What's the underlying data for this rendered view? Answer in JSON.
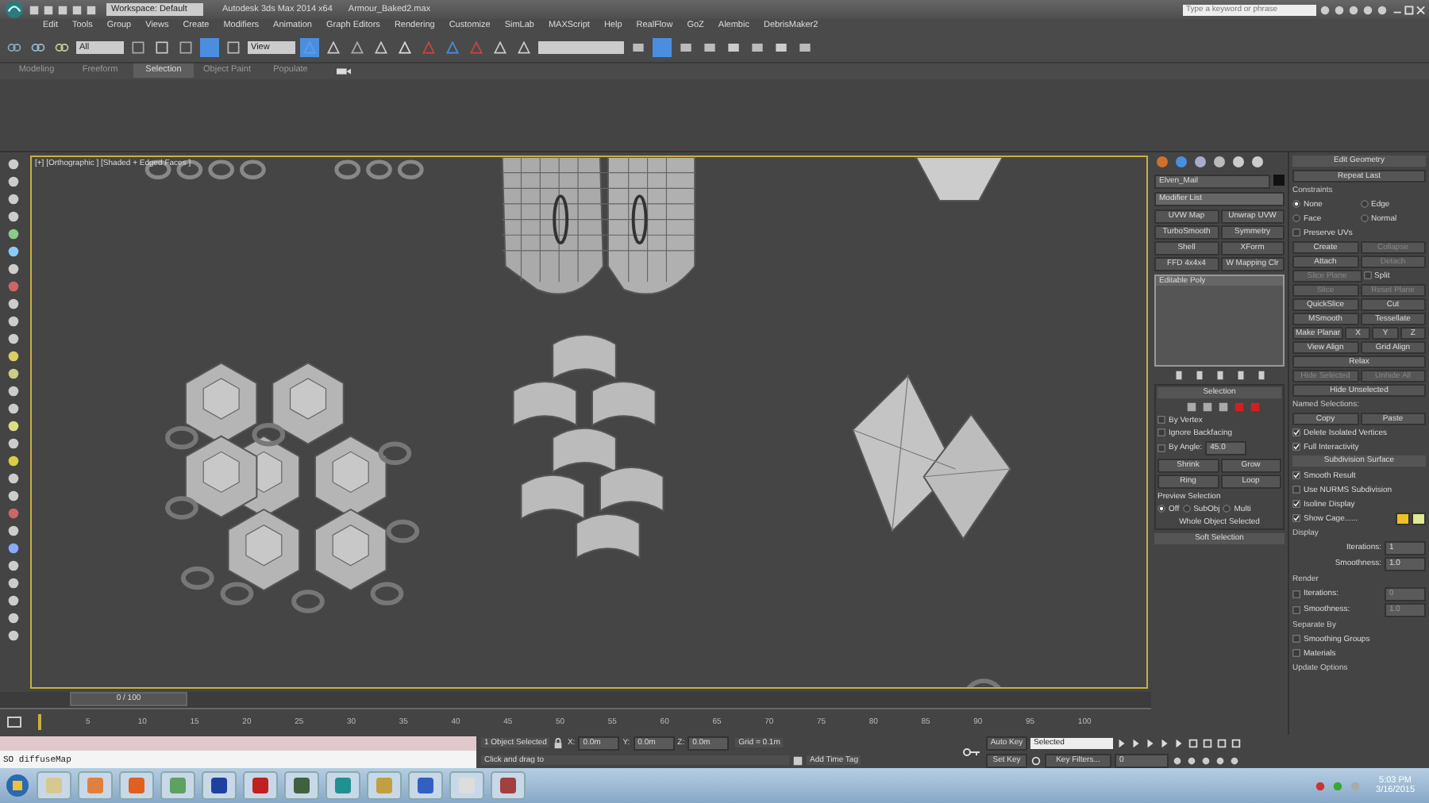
{
  "title_bar": {
    "workspace": "Workspace: Default",
    "title": "Autodesk 3ds Max 2014 x64",
    "file": "Armour_Baked2.max",
    "search": {
      "placeholder": "Type a keyword or phrase"
    }
  },
  "menu": [
    "Edit",
    "Tools",
    "Group",
    "Views",
    "Create",
    "Modifiers",
    "Animation",
    "Graph Editors",
    "Rendering",
    "Customize",
    "SimLab",
    "MAXScript",
    "Help",
    "RealFlow",
    "GoZ",
    "Alembic",
    "DebrisMaker2"
  ],
  "toolbar": {
    "selection_filter": "All",
    "reference_coord": "View"
  },
  "ribbon_tabs": [
    {
      "label": "Modeling",
      "selected": false
    },
    {
      "label": "Freeform",
      "selected": false
    },
    {
      "label": "Selection",
      "selected": true
    },
    {
      "label": "Object Paint",
      "selected": false
    },
    {
      "label": "Populate",
      "selected": false
    }
  ],
  "viewport": {
    "label": "[+] [Orthographic ] [Shaded + Edged Faces ]"
  },
  "command_panel": {
    "object_name": "Elven_Mail",
    "modifier_list": "Modifier List",
    "modifier_buttons": [
      "UVW Map",
      "Unwrap UVW",
      "TurboSmooth",
      "Symmetry",
      "Shell",
      "XForm",
      "FFD 4x4x4",
      "W Mapping Clr"
    ],
    "stack": [
      {
        "label": "Editable Poly",
        "selected": true
      }
    ],
    "selection": {
      "title": "Selection",
      "checks": [
        {
          "label": "By Vertex",
          "checked": false
        },
        {
          "label": "Ignore Backfacing",
          "checked": false
        },
        {
          "label": "By Angle:",
          "checked": false
        }
      ],
      "angle": "45.0",
      "buttons": [
        "Shrink",
        "Grow",
        "Ring",
        "Loop"
      ],
      "preview_title": "Preview Selection",
      "preview": [
        {
          "label": "Off",
          "selected": true
        },
        {
          "label": "SubObj",
          "selected": false
        },
        {
          "label": "Multi",
          "selected": false
        }
      ],
      "status": "Whole Object Selected"
    },
    "soft_selection": "Soft Selection"
  },
  "edit_geometry": {
    "rows": [
      [
        {
          "kind": "header",
          "label": "Edit Geometry"
        }
      ],
      [
        {
          "kind": "button",
          "label": "Repeat Last",
          "disabled": false
        }
      ],
      [
        {
          "kind": "label",
          "label": "Constraints"
        }
      ],
      [
        {
          "kind": "radio",
          "label": "None",
          "selected": true
        },
        {
          "kind": "radio",
          "label": "Edge",
          "selected": false
        }
      ],
      [
        {
          "kind": "radio",
          "label": "Face",
          "selected": false
        },
        {
          "kind": "radio",
          "label": "Normal",
          "selected": false
        }
      ],
      [
        {
          "kind": "check",
          "label": "Preserve UVs",
          "checked": false
        }
      ],
      [
        {
          "kind": "button",
          "label": "Create",
          "disabled": false
        },
        {
          "kind": "button",
          "label": "Collapse",
          "disabled": true
        }
      ],
      [
        {
          "kind": "button",
          "label": "Attach",
          "disabled": false
        },
        {
          "kind": "button",
          "label": "Detach",
          "disabled": true
        }
      ],
      [
        {
          "kind": "button",
          "label": "Slice Plane",
          "disabled": true
        },
        {
          "kind": "check",
          "label": "Split",
          "checked": false
        }
      ],
      [
        {
          "kind": "button",
          "label": "Slice",
          "disabled": true
        },
        {
          "kind": "button",
          "label": "Reset Plane",
          "disabled": true
        }
      ],
      [
        {
          "kind": "button",
          "label": "QuickSlice",
          "disabled": false
        },
        {
          "kind": "button",
          "label": "Cut",
          "disabled": false
        }
      ],
      [
        {
          "kind": "button",
          "label": "MSmooth",
          "disabled": false
        },
        {
          "kind": "button",
          "label": "Tessellate",
          "disabled": false
        }
      ],
      [
        {
          "kind": "button",
          "label": "Make Planar",
          "disabled": false
        },
        {
          "kind": "button",
          "label": "X",
          "disabled": false
        },
        {
          "kind": "button",
          "label": "Y",
          "disabled": false
        },
        {
          "kind": "button",
          "label": "Z",
          "disabled": false
        }
      ],
      [
        {
          "kind": "button",
          "label": "View Align",
          "disabled": false
        },
        {
          "kind": "button",
          "label": "Grid Align",
          "disabled": false
        }
      ],
      [
        {
          "kind": "button",
          "label": "Relax",
          "disabled": false
        }
      ],
      [
        {
          "kind": "button",
          "label": "Hide Selected",
          "disabled": true
        },
        {
          "kind": "button",
          "label": "Unhide All",
          "disabled": true
        }
      ],
      [
        {
          "kind": "button",
          "label": "Hide Unselected",
          "disabled": false
        }
      ],
      [
        {
          "kind": "label",
          "label": "Named Selections:"
        }
      ],
      [
        {
          "kind": "button",
          "label": "Copy",
          "disabled": false
        },
        {
          "kind": "button",
          "label": "Paste",
          "disabled": false
        }
      ],
      [
        {
          "kind": "check",
          "label": "Delete Isolated Vertices",
          "checked": true
        }
      ],
      [
        {
          "kind": "check",
          "label": "Full Interactivity",
          "checked": true
        }
      ],
      [
        {
          "kind": "header",
          "label": "Subdivision Surface"
        }
      ],
      [
        {
          "kind": "check",
          "label": "Smooth Result",
          "checked": true
        }
      ],
      [
        {
          "kind": "check",
          "label": "Use NURMS Subdivision",
          "checked": false
        }
      ],
      [
        {
          "kind": "check",
          "label": "Isoline Display",
          "checked": true
        }
      ],
      [
        {
          "kind": "check",
          "label": "Show Cage......",
          "checked": true
        },
        {
          "kind": "swatch",
          "color": "#f0c020"
        },
        {
          "kind": "swatch",
          "color": "#e0e890"
        }
      ],
      [
        {
          "kind": "label",
          "label": "Display"
        }
      ],
      [
        {
          "kind": "spinner",
          "label": "Iterations:",
          "value": "1"
        }
      ],
      [
        {
          "kind": "spinner",
          "label": "Smoothness:",
          "value": "1.0"
        }
      ],
      [
        {
          "kind": "label",
          "label": "Render"
        }
      ],
      [
        {
          "kind": "check_spinner",
          "label": "Iterations:",
          "checked": false,
          "value": "0"
        }
      ],
      [
        {
          "kind": "check_spinner",
          "label": "Smoothness:",
          "checked": false,
          "value": "1.0"
        }
      ],
      [
        {
          "kind": "label",
          "label": "Separate By"
        }
      ],
      [
        {
          "kind": "check",
          "label": "Smoothing Groups",
          "checked": false
        }
      ],
      [
        {
          "kind": "check",
          "label": "Materials",
          "checked": false
        }
      ],
      [
        {
          "kind": "label",
          "label": "Update Options"
        }
      ]
    ]
  },
  "time_slider": {
    "position": "0 / 100",
    "ticks": [
      "5",
      "10",
      "15",
      "20",
      "25",
      "30",
      "35",
      "40",
      "45",
      "50",
      "55",
      "60",
      "65",
      "70",
      "75",
      "80",
      "85",
      "90",
      "95",
      "100"
    ]
  },
  "listener": {
    "output": "SO diffuseMap"
  },
  "status": {
    "selection": "1 Object Selected",
    "prompt": "Click and drag to",
    "coords": [
      {
        "axis": "X:",
        "value": "0.0m"
      },
      {
        "axis": "Y:",
        "value": "0.0m"
      },
      {
        "axis": "Z:",
        "value": "0.0m"
      }
    ],
    "grid": "Grid = 0.1m",
    "time_tag": "Add Time Tag"
  },
  "animation": {
    "auto_key": "Auto Key",
    "key_mode": "Selected",
    "set_key": "Set Key",
    "key_filters": "Key Filters...",
    "frame": "0"
  },
  "taskbar": {
    "time": "5:03 PM",
    "date": "3/16/2015"
  }
}
